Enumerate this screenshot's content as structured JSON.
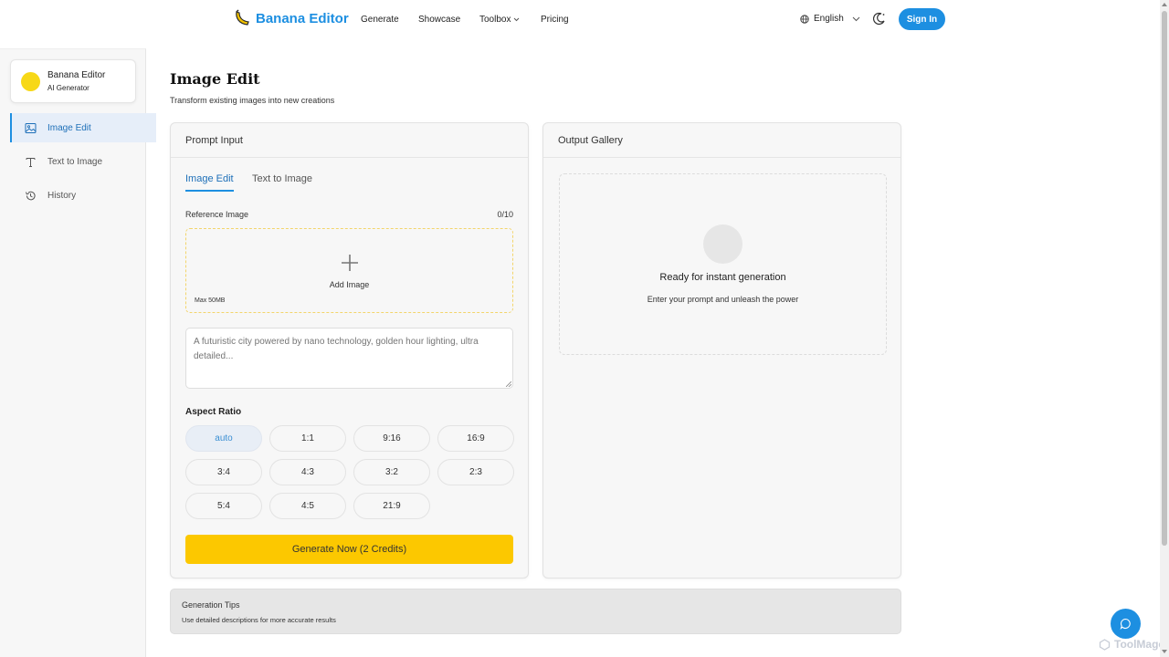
{
  "nav": {
    "brand": "Banana Editor",
    "links": [
      "Generate",
      "Showcase",
      "Toolbox",
      "Pricing"
    ],
    "language": "English",
    "signin": "Sign In"
  },
  "sidebar": {
    "profile_name": "Banana Editor",
    "profile_sub": "AI Generator",
    "items": [
      {
        "label": "Image Edit",
        "icon": "image-icon"
      },
      {
        "label": "Text to Image",
        "icon": "text-icon"
      },
      {
        "label": "History",
        "icon": "history-icon"
      }
    ]
  },
  "main": {
    "title": "Image Edit",
    "subtitle": "Transform existing images into new creations"
  },
  "prompt_card": {
    "header": "Prompt Input",
    "tabs": [
      "Image Edit",
      "Text to Image"
    ],
    "reference_label": "Reference Image",
    "reference_count": "0/10",
    "add_image": "Add Image",
    "max_size": "Max 50MB",
    "prompt_placeholder": "A futuristic city powered by nano technology, golden hour lighting, ultra detailed...",
    "aspect_label": "Aspect Ratio",
    "aspect_ratios": [
      "auto",
      "1:1",
      "9:16",
      "16:9",
      "3:4",
      "4:3",
      "3:2",
      "2:3",
      "5:4",
      "4:5",
      "21:9"
    ],
    "selected_ratio": "auto",
    "generate": "Generate Now (2 Credits)"
  },
  "gallery_card": {
    "header": "Output Gallery",
    "title": "Ready for instant generation",
    "subtitle": "Enter your prompt and unleash the power"
  },
  "tips": {
    "title": "Generation Tips",
    "subtitle": "Use detailed descriptions for more accurate results"
  },
  "watermark": "ToolMage",
  "colors": {
    "accent": "#1d8fe1",
    "generate": "#fcc800",
    "avatar": "#f7d817"
  }
}
